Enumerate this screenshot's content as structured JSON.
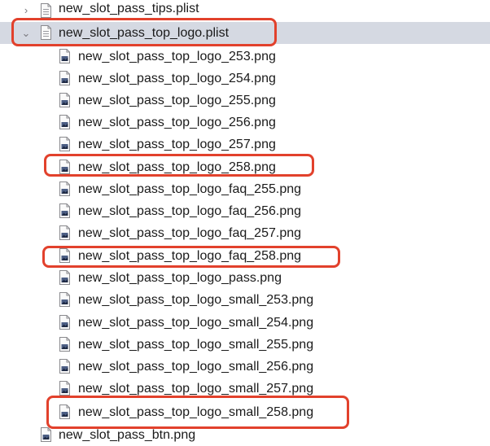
{
  "tree": {
    "top_file": {
      "label": "new_slot_pass_tips.plist",
      "expanded": false,
      "icon": "plist-file-icon"
    },
    "group": {
      "label": "new_slot_pass_top_logo.plist",
      "expanded": true,
      "selected": true,
      "icon": "plist-file-icon",
      "children": [
        {
          "label": "new_slot_pass_top_logo_253.png",
          "highlighted": false,
          "icon": "png-file-icon"
        },
        {
          "label": "new_slot_pass_top_logo_254.png",
          "highlighted": false,
          "icon": "png-file-icon"
        },
        {
          "label": "new_slot_pass_top_logo_255.png",
          "highlighted": false,
          "icon": "png-file-icon"
        },
        {
          "label": "new_slot_pass_top_logo_256.png",
          "highlighted": false,
          "icon": "png-file-icon"
        },
        {
          "label": "new_slot_pass_top_logo_257.png",
          "highlighted": false,
          "icon": "png-file-icon"
        },
        {
          "label": "new_slot_pass_top_logo_258.png",
          "highlighted": true,
          "icon": "png-file-icon"
        },
        {
          "label": "new_slot_pass_top_logo_faq_255.png",
          "highlighted": false,
          "icon": "png-file-icon"
        },
        {
          "label": "new_slot_pass_top_logo_faq_256.png",
          "highlighted": false,
          "icon": "png-file-icon"
        },
        {
          "label": "new_slot_pass_top_logo_faq_257.png",
          "highlighted": false,
          "icon": "png-file-icon"
        },
        {
          "label": "new_slot_pass_top_logo_faq_258.png",
          "highlighted": true,
          "icon": "png-file-icon"
        },
        {
          "label": "new_slot_pass_top_logo_pass.png",
          "highlighted": false,
          "icon": "png-file-icon"
        },
        {
          "label": "new_slot_pass_top_logo_small_253.png",
          "highlighted": false,
          "icon": "png-file-icon"
        },
        {
          "label": "new_slot_pass_top_logo_small_254.png",
          "highlighted": false,
          "icon": "png-file-icon"
        },
        {
          "label": "new_slot_pass_top_logo_small_255.png",
          "highlighted": false,
          "icon": "png-file-icon"
        },
        {
          "label": "new_slot_pass_top_logo_small_256.png",
          "highlighted": false,
          "icon": "png-file-icon"
        },
        {
          "label": "new_slot_pass_top_logo_small_257.png",
          "highlighted": false,
          "icon": "png-file-icon"
        },
        {
          "label": "new_slot_pass_top_logo_small_258.png",
          "highlighted": true,
          "icon": "png-file-icon"
        }
      ]
    },
    "bottom_file": {
      "label": "new_slot_pass_btn.png",
      "icon": "png-file-icon"
    }
  },
  "colors": {
    "selection_bg": "#d5d9e2",
    "highlight_border": "#e2412c",
    "text": "#1a1a1a",
    "disclosure": "#7b7b80"
  }
}
